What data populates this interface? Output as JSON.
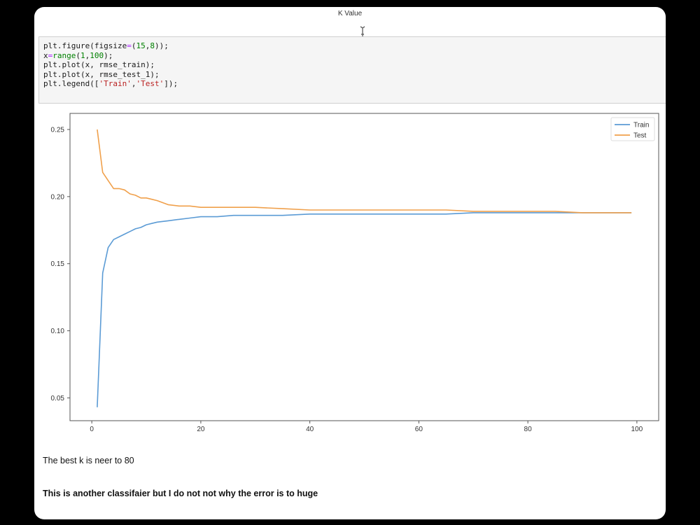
{
  "window": {
    "top_label": "K Value"
  },
  "code_cell": {
    "lines": [
      "plt.figure(figsize=(15,8));",
      "x=range(1,100);",
      "plt.plot(x, rmse_train);",
      "plt.plot(x, rmse_test_1);",
      "plt.legend(['Train','Test']);"
    ]
  },
  "chart_data": {
    "type": "line",
    "xlim": [
      -4,
      104
    ],
    "ylim": [
      0.033,
      0.262
    ],
    "xticks": [
      0,
      20,
      40,
      60,
      80,
      100
    ],
    "yticks": [
      0.05,
      0.1,
      0.15,
      0.2,
      0.25
    ],
    "ytick_labels": [
      "0.05",
      "0.10",
      "0.15",
      "0.20",
      "0.25"
    ],
    "grid": false,
    "legend_position": "top-right",
    "series": [
      {
        "name": "Train",
        "color": "#5b9bd5",
        "x": [
          1,
          2,
          3,
          4,
          5,
          6,
          7,
          8,
          9,
          10,
          11,
          12,
          14,
          16,
          18,
          20,
          23,
          26,
          30,
          35,
          40,
          45,
          50,
          55,
          60,
          65,
          70,
          75,
          80,
          85,
          90,
          95,
          99
        ],
        "values": [
          0.043,
          0.143,
          0.162,
          0.168,
          0.17,
          0.172,
          0.174,
          0.176,
          0.177,
          0.179,
          0.18,
          0.181,
          0.182,
          0.183,
          0.184,
          0.185,
          0.185,
          0.186,
          0.186,
          0.186,
          0.187,
          0.187,
          0.187,
          0.187,
          0.187,
          0.187,
          0.188,
          0.188,
          0.188,
          0.188,
          0.188,
          0.188,
          0.188
        ]
      },
      {
        "name": "Test",
        "color": "#f0a04b",
        "x": [
          1,
          2,
          3,
          4,
          5,
          6,
          7,
          8,
          9,
          10,
          11,
          12,
          14,
          16,
          18,
          20,
          22,
          25,
          28,
          30,
          35,
          40,
          45,
          50,
          55,
          60,
          65,
          70,
          75,
          80,
          85,
          90,
          95,
          99
        ],
        "values": [
          0.25,
          0.218,
          0.212,
          0.206,
          0.206,
          0.205,
          0.202,
          0.201,
          0.199,
          0.199,
          0.198,
          0.197,
          0.194,
          0.193,
          0.193,
          0.192,
          0.192,
          0.192,
          0.192,
          0.192,
          0.191,
          0.19,
          0.19,
          0.19,
          0.19,
          0.19,
          0.19,
          0.189,
          0.189,
          0.189,
          0.189,
          0.188,
          0.188,
          0.188
        ]
      }
    ]
  },
  "markdown": {
    "line1": "The best k is neer to 80",
    "line2": "This is another classifaier but I do not not why the error is to huge"
  }
}
